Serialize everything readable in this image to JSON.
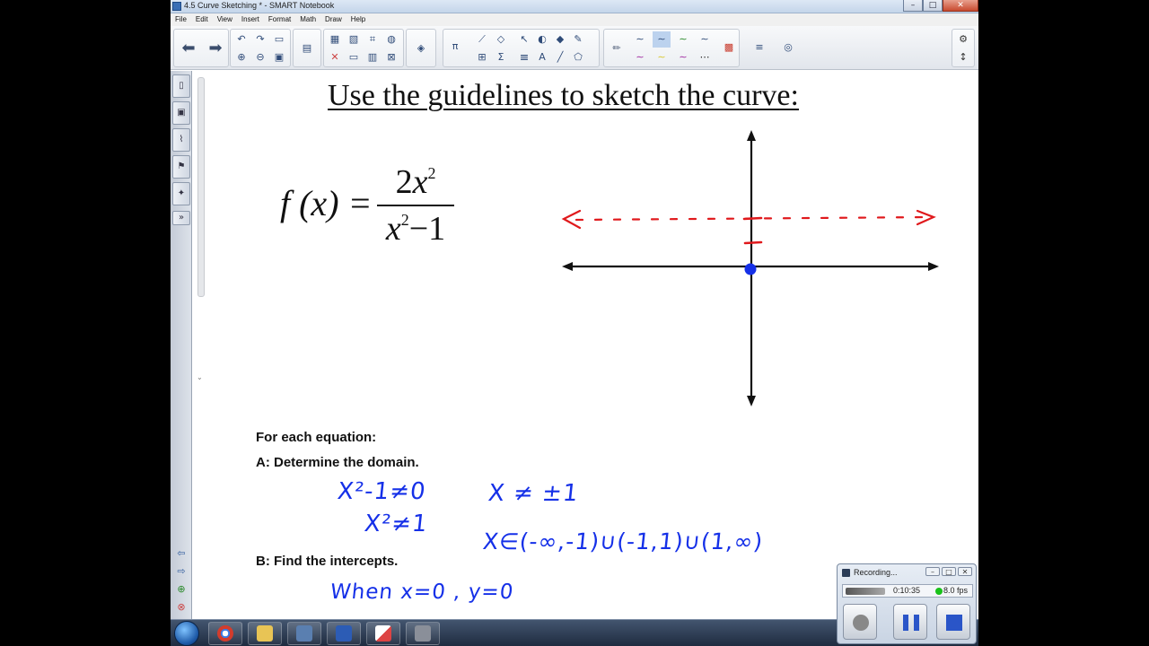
{
  "window": {
    "title": "4.5 Curve Sketching * - SMART Notebook",
    "min_symbol": "–",
    "max_symbol": "□",
    "close_symbol": "✕"
  },
  "menu": [
    "File",
    "Edit",
    "View",
    "Insert",
    "Format",
    "Math",
    "Draw",
    "Help"
  ],
  "page": {
    "title": "Use the guidelines to sketch the curve:",
    "formula": {
      "lhs": "f (x) =",
      "numerator_coef": "2",
      "numerator_var": "x",
      "numerator_exp": "2",
      "denominator_var": "x",
      "denominator_exp": "2",
      "denominator_rest": "−1"
    },
    "guidelines": {
      "heading": "For each equation:",
      "step_a": "A: Determine the domain.",
      "step_b": "B: Find the intercepts."
    },
    "handwriting": {
      "line1_left": "X²-1≠0",
      "line1_right": "X ≠ ±1",
      "line2_left": "X²≠1",
      "line2_right": "X∈(-∞,-1)∪(-1,1)∪(1,∞)",
      "line3": "When x=0 , y=0"
    },
    "ink_colors": {
      "black": "#111111",
      "red": "#e0191c",
      "blue": "#1530e8"
    }
  },
  "recorder": {
    "title": "Recording...",
    "time": "0:10:35",
    "fps": "8.0 fps",
    "win_min": "–",
    "win_max": "□",
    "win_close": "✕"
  },
  "taskbar": {
    "apps": [
      "chrome-icon",
      "folder-icon",
      "notebook-icon",
      "word-icon",
      "paint-icon",
      "recorder-icon"
    ],
    "app_colors": [
      "#d23c2d",
      "#e8c455",
      "#5a7fb0",
      "#2c5cb5",
      "#d44",
      "#8a8f99"
    ]
  }
}
